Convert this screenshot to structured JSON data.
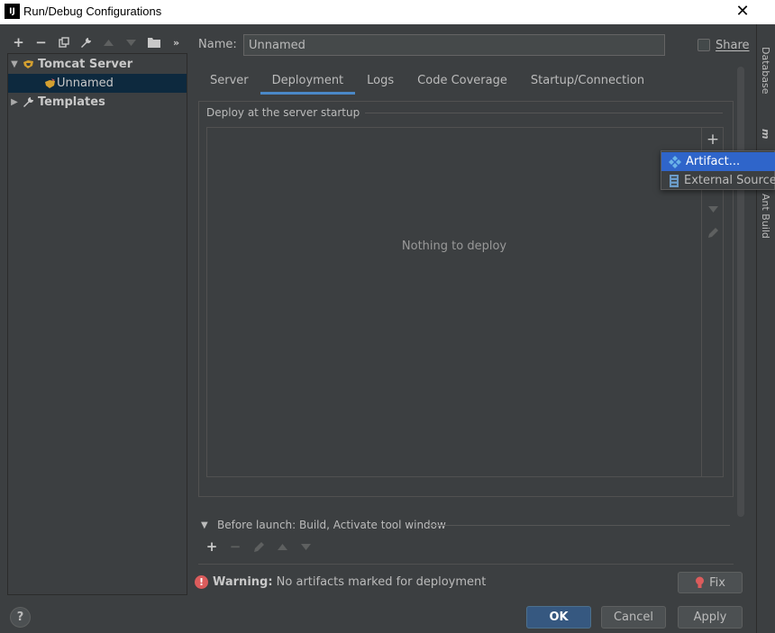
{
  "window": {
    "app_icon": "IJ",
    "title": "Run/Debug Configurations",
    "close_glyph": "✕"
  },
  "left_toolbar": {
    "items": [
      "add-icon",
      "remove-icon",
      "copy-icon",
      "wrench-icon",
      "move-up-icon",
      "move-down-icon",
      "folder-add-icon",
      "more-icon"
    ]
  },
  "tree": {
    "tomcat_label": "Tomcat Server",
    "unnamed_label": "Unnamed",
    "templates_label": "Templates"
  },
  "name_field": {
    "label": "Name:",
    "value": "Unnamed"
  },
  "share": {
    "label": "Share",
    "checked": false
  },
  "tabs": [
    {
      "label": "Server",
      "active": false
    },
    {
      "label": "Deployment",
      "active": true
    },
    {
      "label": "Logs",
      "active": false
    },
    {
      "label": "Code Coverage",
      "active": false
    },
    {
      "label": "Startup/Connection",
      "active": false
    }
  ],
  "deployment": {
    "group_title": "Deploy at the server startup",
    "empty_text": "Nothing to deploy"
  },
  "popup_menu": {
    "items": [
      {
        "label": "Artifact...",
        "icon": "artifact-icon",
        "highlighted": true
      },
      {
        "label": "External Source...",
        "icon": "external-source-icon",
        "highlighted": false
      }
    ]
  },
  "tool_strip": {
    "labels": [
      "Database",
      "m",
      "Ant Build"
    ]
  },
  "before_launch": {
    "label": "Before launch: Build, Activate tool window"
  },
  "warning": {
    "bold": "Warning:",
    "text": " No artifacts marked for deployment",
    "fix_label": "Fix"
  },
  "buttons": {
    "help": "?",
    "ok": "OK",
    "cancel": "Cancel",
    "apply": "Apply"
  },
  "colors": {
    "accent": "#4a88c7",
    "menu_highlight": "#2f65ca",
    "selection": "#0d293e",
    "warning": "#db5c5c",
    "ok_button": "#365880"
  }
}
